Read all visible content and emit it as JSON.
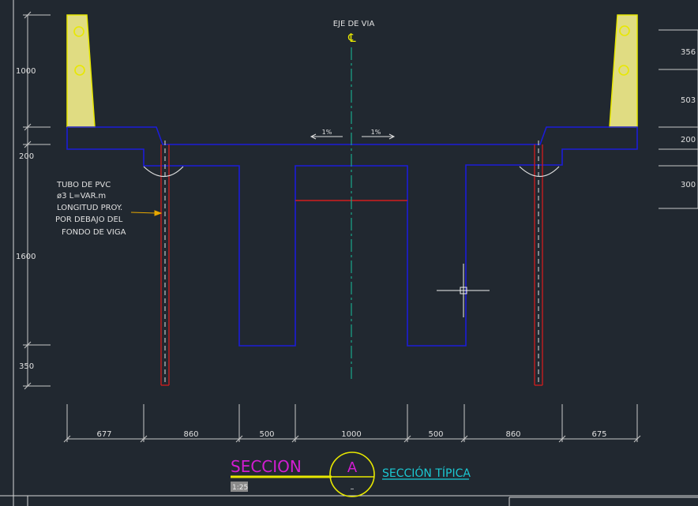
{
  "drawing": {
    "axis_label": "EJE DE VIA",
    "centerline_symbol": "℄",
    "slope_left": "1%",
    "slope_right": "1%",
    "pvc_note": [
      "TUBO DE PVC",
      "ø3 L=VAR.m",
      "LONGITUD PROY.",
      "POR DEBAJO DEL",
      "FONDO DE VIGA"
    ],
    "dims_left": [
      "1000",
      "200",
      "1600",
      "350"
    ],
    "dims_right": [
      "356",
      "503",
      "200",
      "300"
    ],
    "dims_bottom": [
      "677",
      "860",
      "500",
      "1000",
      "500",
      "860",
      "675"
    ]
  },
  "title_block": {
    "title": "SECCION",
    "scale": "1:25",
    "section_letter": "A",
    "section_sub": "–",
    "subtitle": "SECCIÓN TÍPICA"
  },
  "colors": {
    "background": "#212830",
    "structure": "#1c1cd8",
    "barrier_outline": "#e8e800",
    "barrier_fill": "#e0dc82",
    "centerline": "#1aa88a",
    "pipe": "#d21d1d",
    "dimension": "#c8c8c8",
    "title": "#d21dd2",
    "subtitle": "#1bc8d2"
  }
}
